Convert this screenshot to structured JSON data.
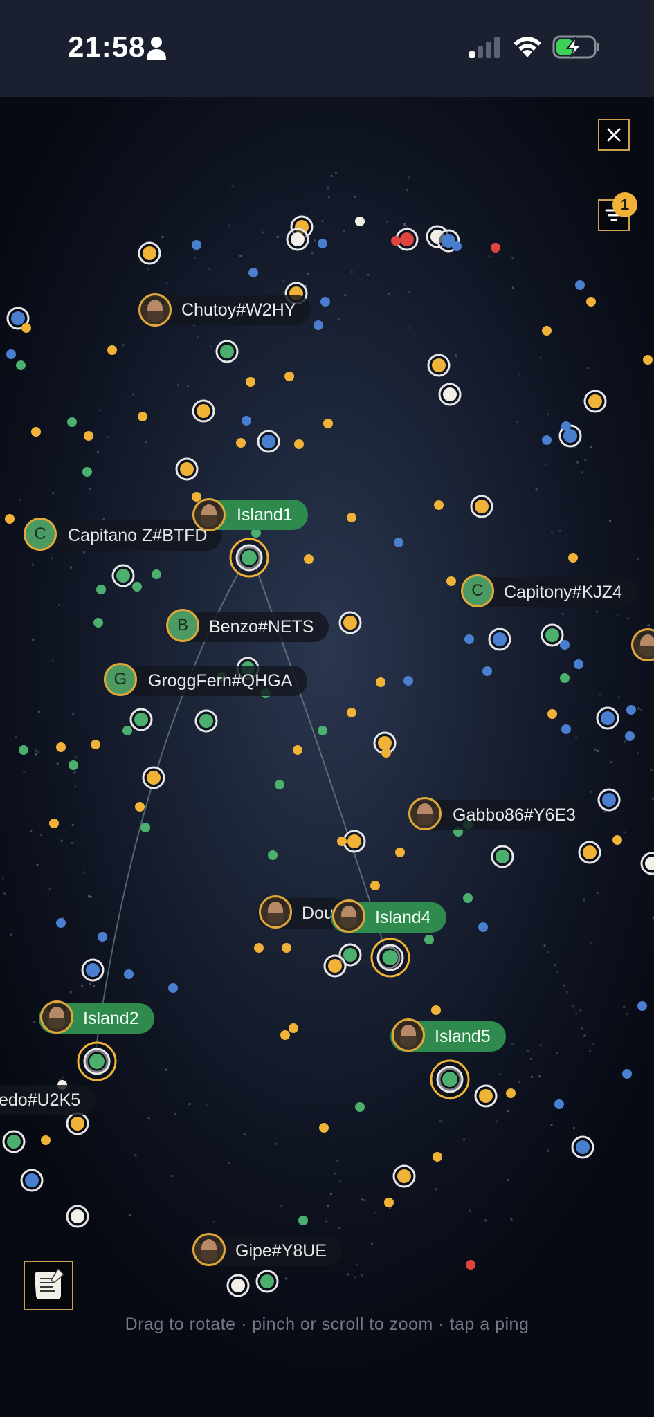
{
  "status_bar": {
    "time": "21:58",
    "icons": [
      "person-icon",
      "signal-icon",
      "wifi-icon",
      "battery-charging-icon"
    ]
  },
  "controls": {
    "close_icon": "close-icon",
    "filter_icon": "filter-icon",
    "filter_badge": "1",
    "scroll_icon": "scroll-icon"
  },
  "players": [
    {
      "name": "Chutoy#W2HY",
      "avatar": "portrait"
    },
    {
      "name": "Capitano Z#BTFD",
      "avatar": "C"
    },
    {
      "name": "Benzo#NETS",
      "avatar": "B"
    },
    {
      "name": "GroggFern#QHGA",
      "avatar": "G"
    },
    {
      "name": "Capitony#KJZ4",
      "avatar": "C"
    },
    {
      "name": "Gabbo86#Y6E3",
      "avatar": "portrait"
    },
    {
      "name": "Dou",
      "avatar": "portrait"
    },
    {
      "name": "edo#U2K5",
      "avatar": "none"
    },
    {
      "name": "Gipe#Y8UE",
      "avatar": "portrait"
    }
  ],
  "islands": [
    {
      "name": "Island1"
    },
    {
      "name": "Island2"
    },
    {
      "name": "Island4"
    },
    {
      "name": "Island5"
    }
  ],
  "hint": "Drag to rotate · pinch or scroll to zoom · tap a ping",
  "colors": {
    "gold": "#f0b237",
    "green": "#4caf6e",
    "blue": "#4a7fd0",
    "red": "#e0443e",
    "white": "#f2efe6",
    "island_label": "#2f8a4e",
    "frame": "#c9a24b"
  }
}
